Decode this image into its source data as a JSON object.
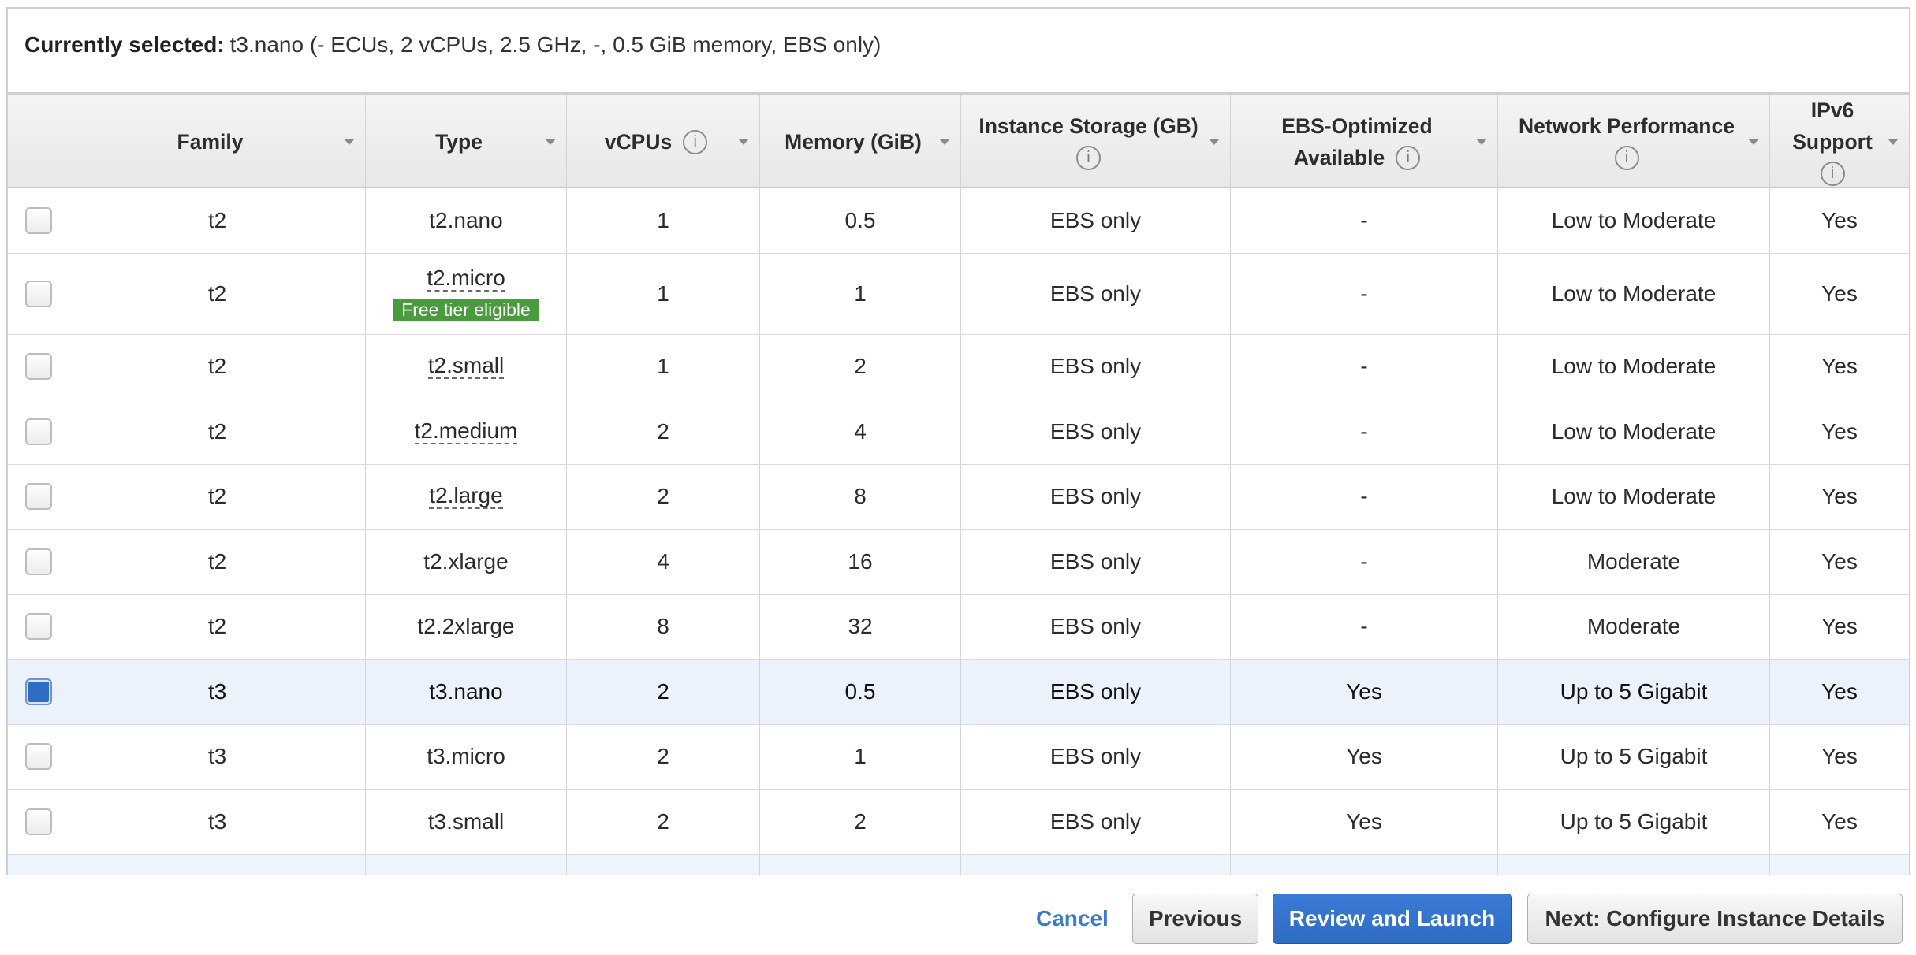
{
  "summary": {
    "label": "Currently selected:",
    "value": "t3.nano (- ECUs, 2 vCPUs, 2.5 GHz, -, 0.5 GiB memory, EBS only)"
  },
  "table": {
    "headers": {
      "family": "Family",
      "type": "Type",
      "vcpus": "vCPUs",
      "memory": "Memory (GiB)",
      "instance_storage": "Instance Storage (GB)",
      "ebs_optimized": [
        "EBS-Optimized",
        "Available"
      ],
      "network_performance": "Network Performance",
      "ipv6_support": [
        "IPv6",
        "Support"
      ]
    },
    "rows": [
      {
        "family": "t2",
        "type": "t2.nano",
        "vcpus": "1",
        "memory_gib": "0.5",
        "instance_storage_gb": "EBS only",
        "ebs_optimized_available": "-",
        "network_performance": "Low to Moderate",
        "ipv6_support": "Yes",
        "selected": false
      },
      {
        "family": "t2",
        "type": "t2.micro",
        "badge": "Free tier eligible",
        "vcpus": "1",
        "memory_gib": "1",
        "instance_storage_gb": "EBS only",
        "ebs_optimized_available": "-",
        "network_performance": "Low to Moderate",
        "ipv6_support": "Yes",
        "selected": false
      },
      {
        "family": "t2",
        "type": "t2.small",
        "vcpus": "1",
        "memory_gib": "2",
        "instance_storage_gb": "EBS only",
        "ebs_optimized_available": "-",
        "network_performance": "Low to Moderate",
        "ipv6_support": "Yes",
        "selected": false
      },
      {
        "family": "t2",
        "type": "t2.medium",
        "vcpus": "2",
        "memory_gib": "4",
        "instance_storage_gb": "EBS only",
        "ebs_optimized_available": "-",
        "network_performance": "Low to Moderate",
        "ipv6_support": "Yes",
        "selected": false
      },
      {
        "family": "t2",
        "type": "t2.large",
        "vcpus": "2",
        "memory_gib": "8",
        "instance_storage_gb": "EBS only",
        "ebs_optimized_available": "-",
        "network_performance": "Low to Moderate",
        "ipv6_support": "Yes",
        "selected": false
      },
      {
        "family": "t2",
        "type": "t2.xlarge",
        "vcpus": "4",
        "memory_gib": "16",
        "instance_storage_gb": "EBS only",
        "ebs_optimized_available": "-",
        "network_performance": "Moderate",
        "ipv6_support": "Yes",
        "selected": false
      },
      {
        "family": "t2",
        "type": "t2.2xlarge",
        "vcpus": "8",
        "memory_gib": "32",
        "instance_storage_gb": "EBS only",
        "ebs_optimized_available": "-",
        "network_performance": "Moderate",
        "ipv6_support": "Yes",
        "selected": false
      },
      {
        "family": "t3",
        "type": "t3.nano",
        "vcpus": "2",
        "memory_gib": "0.5",
        "instance_storage_gb": "EBS only",
        "ebs_optimized_available": "Yes",
        "network_performance": "Up to 5 Gigabit",
        "ipv6_support": "Yes",
        "selected": true
      },
      {
        "family": "t3",
        "type": "t3.micro",
        "vcpus": "2",
        "memory_gib": "1",
        "instance_storage_gb": "EBS only",
        "ebs_optimized_available": "Yes",
        "network_performance": "Up to 5 Gigabit",
        "ipv6_support": "Yes",
        "selected": false
      },
      {
        "family": "t3",
        "type": "t3.small",
        "vcpus": "2",
        "memory_gib": "2",
        "instance_storage_gb": "EBS only",
        "ebs_optimized_available": "Yes",
        "network_performance": "Up to 5 Gigabit",
        "ipv6_support": "Yes",
        "selected": false
      }
    ]
  },
  "footer": {
    "cancel": "Cancel",
    "previous": "Previous",
    "review_and_launch": "Review and Launch",
    "next": "Next: Configure Instance Details"
  },
  "colors": {
    "accent": "#2f6cc4",
    "link": "#3b7bcd",
    "free_tier_badge": "#4a9b3e",
    "selected_row": "#ebf2fc"
  },
  "icons": {
    "column_info": "info-icon",
    "column_sort": "sort-caret-down-icon",
    "row_select": "checkbox"
  }
}
